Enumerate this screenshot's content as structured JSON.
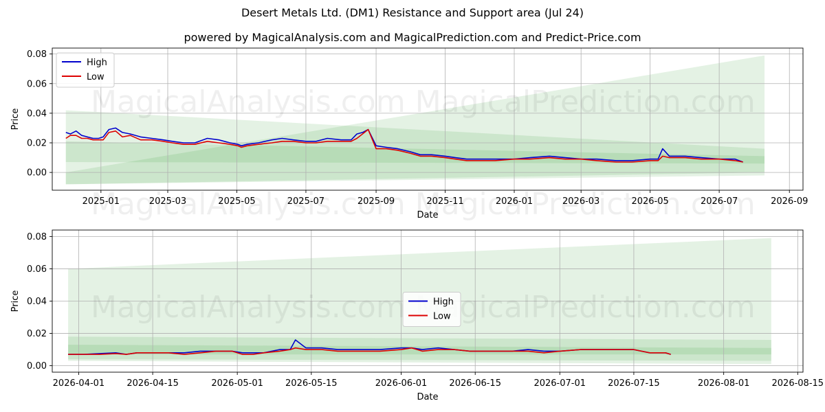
{
  "title": "Desert Metals Ltd. (DM1) Resistance and Support area (Jul 24)",
  "subtitle": "powered by MagicalAnalysis.com and MagicalPrediction.com and Predict-Price.com",
  "watermarks": [
    "MagicalAnalysis.com",
    "MagicalPrediction.com"
  ],
  "colors": {
    "high": "#0000cc",
    "low": "#dd0000",
    "band": "#2e9e2e"
  },
  "chart_data": [
    {
      "type": "line",
      "xlabel": "Date",
      "ylabel": "Price",
      "xlim": [
        "2024-11-19",
        "2026-09-13"
      ],
      "ylim": [
        -0.012,
        0.084
      ],
      "xticks": [
        "2025-01-01",
        "2025-03-01",
        "2025-05-01",
        "2025-07-01",
        "2025-09-01",
        "2025-11-01",
        "2026-01-01",
        "2026-03-01",
        "2026-05-01",
        "2026-07-01",
        "2026-09-01"
      ],
      "xtick_labels": [
        "2025-01",
        "2025-03",
        "2025-05",
        "2025-07",
        "2025-09",
        "2025-11",
        "2026-01",
        "2026-03",
        "2026-05",
        "2026-07",
        "2026-09"
      ],
      "yticks": [
        0.0,
        0.02,
        0.04,
        0.06,
        0.08
      ],
      "ytick_labels": [
        "0.00",
        "0.02",
        "0.04",
        "0.06",
        "0.08"
      ],
      "grid": true,
      "legend": {
        "position": "top-left",
        "entries": [
          "High",
          "Low"
        ]
      },
      "bands": [
        {
          "x": [
            "2024-12-01",
            "2026-08-10"
          ],
          "upper": [
            0.042,
            0.016
          ],
          "lower": [
            -0.008,
            -0.002
          ]
        },
        {
          "x": [
            "2024-12-01",
            "2026-08-10"
          ],
          "upper": [
            0.021,
            0.011
          ],
          "lower": [
            0.007,
            0.006
          ]
        },
        {
          "x": [
            "2024-12-01",
            "2026-08-10"
          ],
          "upper": [
            0.0,
            0.079
          ],
          "lower": [
            -0.008,
            0.0
          ]
        }
      ],
      "series": [
        {
          "name": "High",
          "x": [
            "2024-12-01",
            "2024-12-05",
            "2024-12-10",
            "2024-12-15",
            "2024-12-20",
            "2024-12-25",
            "2024-12-30",
            "2025-01-03",
            "2025-01-08",
            "2025-01-14",
            "2025-01-20",
            "2025-01-27",
            "2025-02-05",
            "2025-02-15",
            "2025-02-25",
            "2025-03-05",
            "2025-03-15",
            "2025-03-25",
            "2025-04-05",
            "2025-04-15",
            "2025-04-25",
            "2025-05-02",
            "2025-05-05",
            "2025-05-10",
            "2025-05-20",
            "2025-06-01",
            "2025-06-10",
            "2025-06-20",
            "2025-07-01",
            "2025-07-10",
            "2025-07-20",
            "2025-08-01",
            "2025-08-10",
            "2025-08-15",
            "2025-08-20",
            "2025-08-25",
            "2025-09-01",
            "2025-09-10",
            "2025-09-20",
            "2025-10-01",
            "2025-10-10",
            "2025-10-20",
            "2025-11-01",
            "2025-11-10",
            "2025-11-20",
            "2025-12-01",
            "2025-12-15",
            "2026-01-01",
            "2026-01-15",
            "2026-02-01",
            "2026-02-15",
            "2026-03-01",
            "2026-03-15",
            "2026-04-01",
            "2026-04-15",
            "2026-05-01",
            "2026-05-08",
            "2026-05-12",
            "2026-05-18",
            "2026-06-01",
            "2026-06-15",
            "2026-07-01",
            "2026-07-15",
            "2026-07-22"
          ],
          "values": [
            0.027,
            0.026,
            0.028,
            0.025,
            0.024,
            0.023,
            0.023,
            0.024,
            0.029,
            0.03,
            0.027,
            0.026,
            0.024,
            0.023,
            0.022,
            0.021,
            0.02,
            0.02,
            0.023,
            0.022,
            0.02,
            0.019,
            0.018,
            0.019,
            0.02,
            0.022,
            0.023,
            0.022,
            0.021,
            0.021,
            0.023,
            0.022,
            0.022,
            0.026,
            0.027,
            0.029,
            0.018,
            0.017,
            0.016,
            0.014,
            0.012,
            0.012,
            0.011,
            0.01,
            0.009,
            0.009,
            0.009,
            0.009,
            0.01,
            0.011,
            0.01,
            0.009,
            0.009,
            0.008,
            0.008,
            0.009,
            0.009,
            0.016,
            0.011,
            0.011,
            0.01,
            0.009,
            0.009,
            0.007
          ]
        },
        {
          "name": "Low",
          "x": [
            "2024-12-01",
            "2024-12-05",
            "2024-12-10",
            "2024-12-15",
            "2024-12-20",
            "2024-12-25",
            "2024-12-30",
            "2025-01-03",
            "2025-01-08",
            "2025-01-14",
            "2025-01-20",
            "2025-01-27",
            "2025-02-05",
            "2025-02-15",
            "2025-02-25",
            "2025-03-05",
            "2025-03-15",
            "2025-03-25",
            "2025-04-05",
            "2025-04-15",
            "2025-04-25",
            "2025-05-02",
            "2025-05-05",
            "2025-05-10",
            "2025-05-20",
            "2025-06-01",
            "2025-06-10",
            "2025-06-20",
            "2025-07-01",
            "2025-07-10",
            "2025-07-20",
            "2025-08-01",
            "2025-08-10",
            "2025-08-15",
            "2025-08-20",
            "2025-08-25",
            "2025-09-01",
            "2025-09-10",
            "2025-09-20",
            "2025-10-01",
            "2025-10-10",
            "2025-10-20",
            "2025-11-01",
            "2025-11-10",
            "2025-11-20",
            "2025-12-01",
            "2025-12-15",
            "2026-01-01",
            "2026-01-15",
            "2026-02-01",
            "2026-02-15",
            "2026-03-01",
            "2026-03-15",
            "2026-04-01",
            "2026-04-15",
            "2026-05-01",
            "2026-05-08",
            "2026-05-12",
            "2026-05-18",
            "2026-06-01",
            "2026-06-15",
            "2026-07-01",
            "2026-07-15",
            "2026-07-22"
          ],
          "values": [
            0.023,
            0.025,
            0.025,
            0.023,
            0.023,
            0.022,
            0.022,
            0.022,
            0.027,
            0.028,
            0.024,
            0.025,
            0.022,
            0.022,
            0.021,
            0.02,
            0.019,
            0.019,
            0.021,
            0.02,
            0.019,
            0.018,
            0.017,
            0.018,
            0.019,
            0.02,
            0.021,
            0.021,
            0.02,
            0.02,
            0.021,
            0.021,
            0.021,
            0.023,
            0.026,
            0.029,
            0.016,
            0.016,
            0.015,
            0.013,
            0.011,
            0.011,
            0.01,
            0.009,
            0.008,
            0.008,
            0.008,
            0.009,
            0.009,
            0.01,
            0.009,
            0.009,
            0.008,
            0.007,
            0.007,
            0.008,
            0.008,
            0.011,
            0.01,
            0.01,
            0.009,
            0.009,
            0.008,
            0.007
          ]
        }
      ]
    },
    {
      "type": "line",
      "xlabel": "Date",
      "ylabel": "Price",
      "xlim": [
        "2026-03-27",
        "2026-08-16"
      ],
      "ylim": [
        -0.004,
        0.084
      ],
      "xticks": [
        "2026-04-01",
        "2026-04-15",
        "2026-05-01",
        "2026-05-15",
        "2026-06-01",
        "2026-06-15",
        "2026-07-01",
        "2026-07-15",
        "2026-08-01",
        "2026-08-15"
      ],
      "xtick_labels": [
        "2026-04-01",
        "2026-04-15",
        "2026-05-01",
        "2026-05-15",
        "2026-06-01",
        "2026-06-15",
        "2026-07-01",
        "2026-07-15",
        "2026-08-01",
        "2026-08-15"
      ],
      "yticks": [
        0.0,
        0.02,
        0.04,
        0.06,
        0.08
      ],
      "ytick_labels": [
        "0.00",
        "0.02",
        "0.04",
        "0.06",
        "0.08"
      ],
      "grid": true,
      "legend": {
        "position": "center",
        "entries": [
          "High",
          "Low"
        ]
      },
      "bands": [
        {
          "x": [
            "2026-03-30",
            "2026-08-10"
          ],
          "upper": [
            0.06,
            0.079
          ],
          "lower": [
            0.003,
            0.001
          ]
        },
        {
          "x": [
            "2026-03-30",
            "2026-08-10"
          ],
          "upper": [
            0.018,
            0.016
          ],
          "lower": [
            0.004,
            0.003
          ]
        },
        {
          "x": [
            "2026-03-30",
            "2026-08-10"
          ],
          "upper": [
            0.013,
            0.011
          ],
          "lower": [
            0.007,
            0.007
          ]
        }
      ],
      "series": [
        {
          "name": "High",
          "x": [
            "2026-03-30",
            "2026-04-02",
            "2026-04-05",
            "2026-04-08",
            "2026-04-10",
            "2026-04-12",
            "2026-04-15",
            "2026-04-18",
            "2026-04-21",
            "2026-04-24",
            "2026-04-27",
            "2026-04-30",
            "2026-05-02",
            "2026-05-04",
            "2026-05-06",
            "2026-05-09",
            "2026-05-11",
            "2026-05-12",
            "2026-05-14",
            "2026-05-17",
            "2026-05-20",
            "2026-05-24",
            "2026-05-28",
            "2026-06-01",
            "2026-06-03",
            "2026-06-05",
            "2026-06-08",
            "2026-06-11",
            "2026-06-14",
            "2026-06-18",
            "2026-06-22",
            "2026-06-25",
            "2026-06-28",
            "2026-07-01",
            "2026-07-05",
            "2026-07-10",
            "2026-07-15",
            "2026-07-18",
            "2026-07-21",
            "2026-07-22"
          ],
          "values": [
            0.007,
            0.007,
            0.0075,
            0.008,
            0.007,
            0.008,
            0.008,
            0.008,
            0.008,
            0.009,
            0.009,
            0.009,
            0.008,
            0.008,
            0.008,
            0.01,
            0.01,
            0.016,
            0.011,
            0.011,
            0.01,
            0.01,
            0.01,
            0.011,
            0.011,
            0.01,
            0.011,
            0.01,
            0.009,
            0.009,
            0.009,
            0.01,
            0.009,
            0.009,
            0.01,
            0.01,
            0.01,
            0.008,
            0.008,
            0.007
          ]
        },
        {
          "name": "Low",
          "x": [
            "2026-03-30",
            "2026-04-02",
            "2026-04-05",
            "2026-04-08",
            "2026-04-10",
            "2026-04-12",
            "2026-04-15",
            "2026-04-18",
            "2026-04-21",
            "2026-04-24",
            "2026-04-27",
            "2026-04-30",
            "2026-05-02",
            "2026-05-04",
            "2026-05-06",
            "2026-05-09",
            "2026-05-11",
            "2026-05-12",
            "2026-05-14",
            "2026-05-17",
            "2026-05-20",
            "2026-05-24",
            "2026-05-28",
            "2026-06-01",
            "2026-06-03",
            "2026-06-05",
            "2026-06-08",
            "2026-06-11",
            "2026-06-14",
            "2026-06-18",
            "2026-06-22",
            "2026-06-25",
            "2026-06-28",
            "2026-07-01",
            "2026-07-05",
            "2026-07-10",
            "2026-07-15",
            "2026-07-18",
            "2026-07-21",
            "2026-07-22"
          ],
          "values": [
            0.007,
            0.007,
            0.007,
            0.0075,
            0.007,
            0.008,
            0.008,
            0.008,
            0.007,
            0.008,
            0.009,
            0.009,
            0.007,
            0.007,
            0.008,
            0.009,
            0.01,
            0.011,
            0.01,
            0.01,
            0.009,
            0.009,
            0.009,
            0.01,
            0.011,
            0.009,
            0.01,
            0.01,
            0.009,
            0.009,
            0.009,
            0.009,
            0.008,
            0.009,
            0.01,
            0.01,
            0.01,
            0.008,
            0.008,
            0.007
          ]
        }
      ]
    }
  ]
}
